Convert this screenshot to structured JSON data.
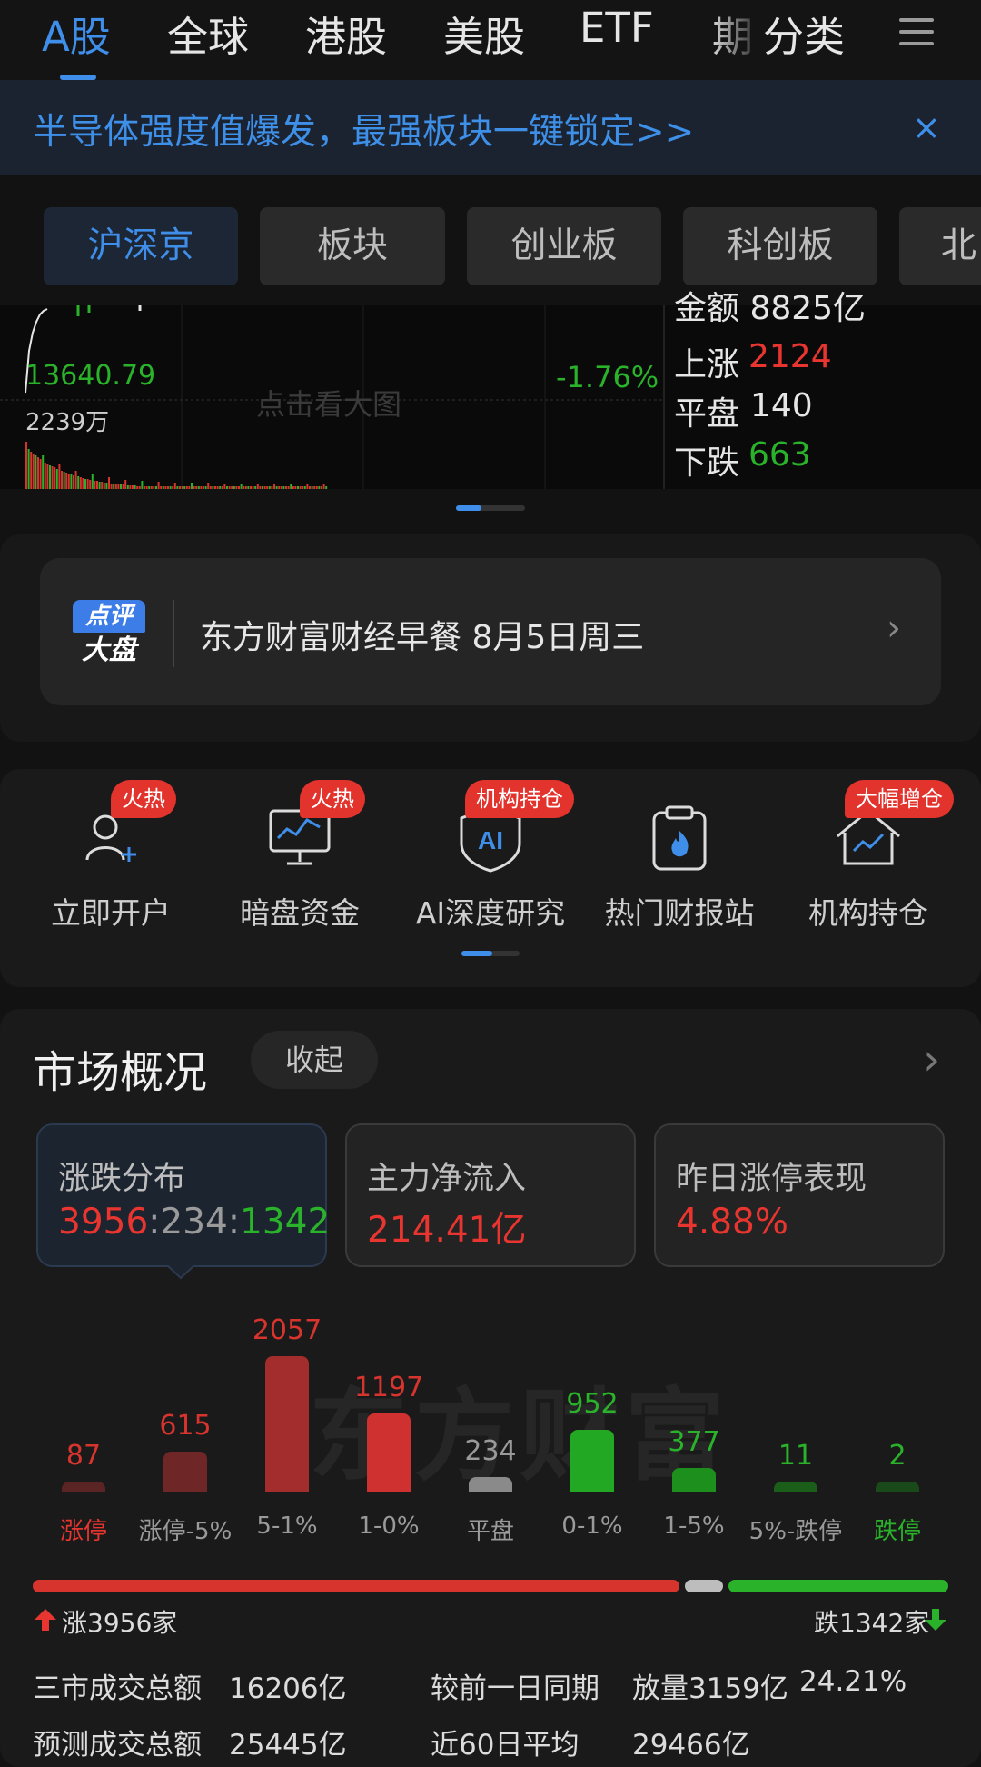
{
  "nav": {
    "tabs": [
      "A股",
      "全球",
      "港股",
      "美股",
      "ETF",
      "期",
      "分类"
    ],
    "active": "A股"
  },
  "banner": {
    "text": "半导体强度值爆发，最强板块一键锁定>>",
    "close": "×"
  },
  "markets": {
    "chips": [
      "沪深京",
      "板块",
      "创业板",
      "科创板",
      "北"
    ],
    "active": "沪深京"
  },
  "index_chart": {
    "price": "13640.79",
    "change": "-1.76%",
    "volume": "2239万",
    "hint": "点击看大图",
    "amount": "金额 8825亿",
    "up_label": "上涨",
    "up_value": "2124",
    "flat_label": "平盘",
    "flat_value": "140",
    "down_label": "下跌",
    "down_value": "663"
  },
  "news_card": {
    "badge_top": "点评",
    "badge_bottom": "大盘",
    "title": "东方财富财经早餐 8月5日周三"
  },
  "shortcuts": [
    {
      "label": "立即开户",
      "tag": "火热",
      "icon": "user-add-icon"
    },
    {
      "label": "暗盘资金",
      "tag": "火热",
      "icon": "monitor-chart-icon"
    },
    {
      "label": "AI深度研究",
      "tag": "机构持仓",
      "icon": "ai-shield-icon"
    },
    {
      "label": "热门财报站",
      "tag": "",
      "icon": "fire-clipboard-icon"
    },
    {
      "label": "机构持仓",
      "tag": "大幅增仓",
      "icon": "house-trend-icon"
    }
  ],
  "overview": {
    "title": "市场概况",
    "collapse": "收起",
    "boxes": [
      {
        "title": "涨跌分布",
        "up": "3956",
        "flat": "234",
        "down": "1342"
      },
      {
        "title": "主力净流入",
        "value": "214.41亿"
      },
      {
        "title": "昨日涨停表现",
        "value": "4.88%"
      }
    ],
    "watermark": "东方财富",
    "rise_total": "涨3956家",
    "fall_total": "跌1342家",
    "stats": {
      "total_label": "三市成交总额",
      "total_value": "16206亿",
      "compare_label": "较前一日同期",
      "compare_value": "放量3159亿",
      "compare_pct": "24.21%",
      "forecast_label": "预测成交总额",
      "forecast_value": "25445亿",
      "avg_label": "近60日平均",
      "avg_value": "29466亿"
    }
  },
  "chart_data": {
    "type": "bar",
    "categories": [
      "涨停",
      "涨停-5%",
      "5-1%",
      "1-0%",
      "平盘",
      "0-1%",
      "1-5%",
      "5%-跌停",
      "跌停"
    ],
    "values": [
      87,
      615,
      2057,
      1197,
      234,
      952,
      377,
      11,
      2
    ],
    "colors": [
      "#5a2424",
      "#6e2626",
      "#a32c2c",
      "#cf3030",
      "#8a8a8a",
      "#22a822",
      "#1d8f1d",
      "#1a5e1a",
      "#1a4a1a"
    ],
    "value_colors": [
      "#d8342e",
      "#d8342e",
      "#d8342e",
      "#d8342e",
      "#9a9a9a",
      "#2ab32a",
      "#2ab32a",
      "#2ab32a",
      "#2ab32a"
    ],
    "label_colors": [
      "#e8352f",
      "#9a9a9a",
      "#9a9a9a",
      "#9a9a9a",
      "#9a9a9a",
      "#9a9a9a",
      "#9a9a9a",
      "#9a9a9a",
      "#2ab32a"
    ],
    "ylim": [
      0,
      2057
    ]
  },
  "breadth": {
    "up": 3956,
    "flat": 234,
    "down": 1342
  }
}
